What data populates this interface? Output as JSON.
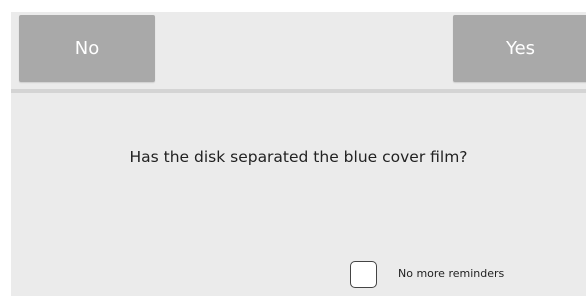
{
  "dialog": {
    "buttons": {
      "no_label": "No",
      "yes_label": "Yes"
    },
    "question": "Has the disk separated the blue cover film?",
    "reminder": {
      "checked": false,
      "label": "No more reminders"
    }
  },
  "colors": {
    "dialog_background": "#ebebeb",
    "button_background": "#a9a9a9",
    "button_text": "#ffffff",
    "divider": "#d4d4d4"
  }
}
